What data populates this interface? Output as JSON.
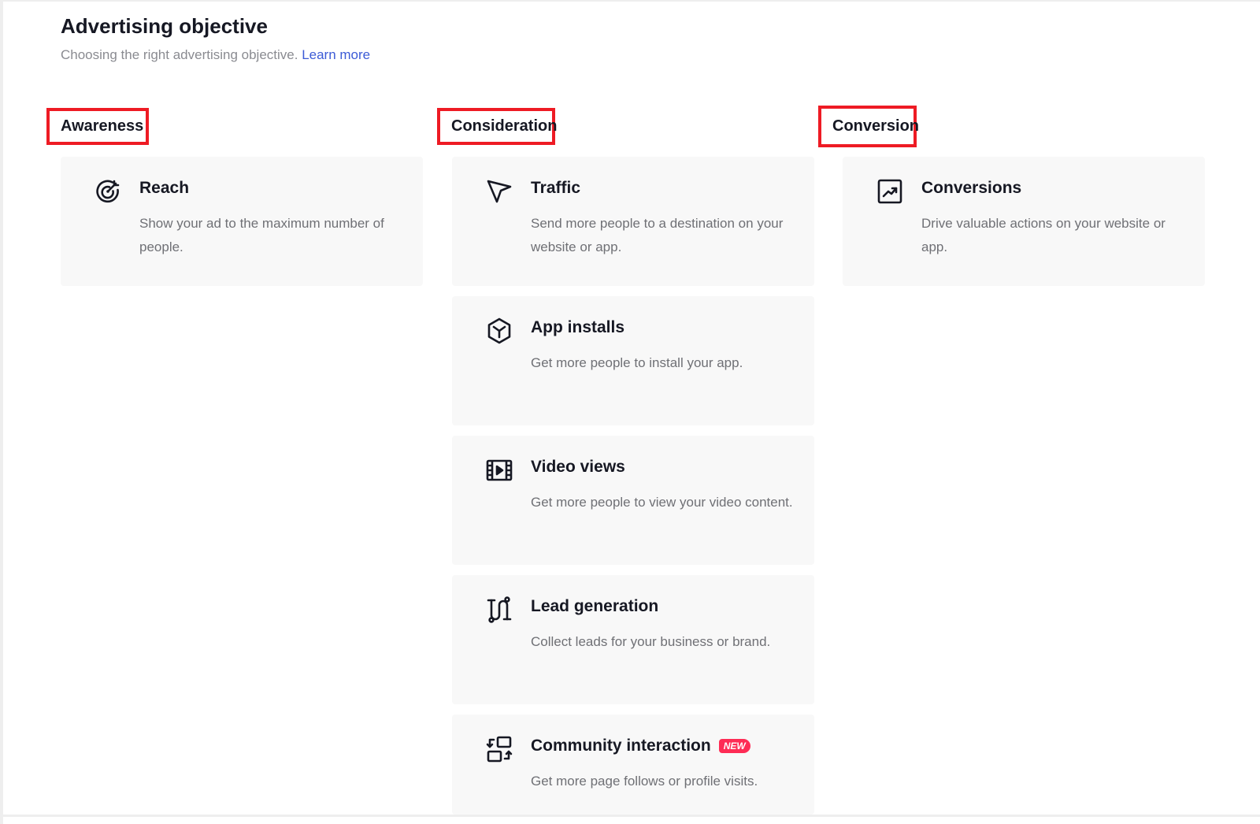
{
  "header": {
    "title": "Advertising objective",
    "subtitle": "Choosing the right advertising objective.",
    "learn_more": "Learn more"
  },
  "sections": {
    "awareness": {
      "heading": "Awareness",
      "cards": [
        {
          "title": "Reach",
          "description": "Show your ad to the maximum number of people.",
          "icon": "target-icon"
        }
      ]
    },
    "consideration": {
      "heading": "Consideration",
      "cards": [
        {
          "title": "Traffic",
          "description": "Send more people to a destination on your website or app.",
          "icon": "cursor-arrow-icon"
        },
        {
          "title": "App installs",
          "description": "Get more people to install your app.",
          "icon": "hexagon-box-icon"
        },
        {
          "title": "Video views",
          "description": "Get more people to view your video content.",
          "icon": "film-play-icon"
        },
        {
          "title": "Lead generation",
          "description": "Collect leads for your business or brand.",
          "icon": "magnet-icon"
        },
        {
          "title": "Community interaction",
          "badge": "NEW",
          "description": "Get more page follows or profile visits.",
          "icon": "swap-frames-icon"
        }
      ]
    },
    "conversion": {
      "heading": "Conversion",
      "cards": [
        {
          "title": "Conversions",
          "description": "Drive valuable actions on your website or app.",
          "icon": "trend-chart-icon"
        }
      ]
    }
  },
  "colors": {
    "highlight_border": "#ee1b24",
    "link": "#3c5bd6",
    "card_background": "#f8f8f8",
    "badge": "#fe2c55"
  }
}
